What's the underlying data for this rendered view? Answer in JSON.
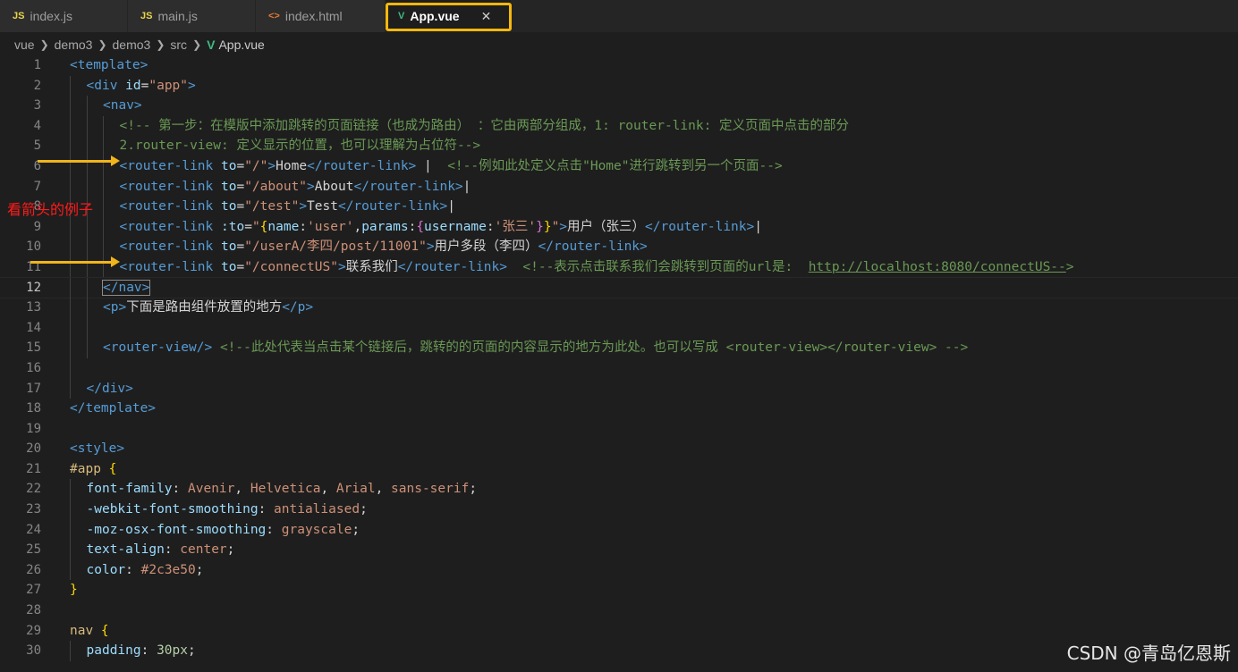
{
  "tabs": [
    {
      "icon": "JS",
      "label": "index.js"
    },
    {
      "icon": "JS",
      "label": "main.js"
    },
    {
      "icon": "<>",
      "label": "index.html"
    },
    {
      "icon": "V",
      "label": "App.vue",
      "close": "✕"
    }
  ],
  "breadcrumb": [
    "vue",
    "demo3",
    "demo3",
    "src",
    "App.vue"
  ],
  "annotation": "看箭头的例子",
  "watermark": "CSDN @青岛亿恩斯",
  "lines": [
    {
      "n": "1",
      "code": [
        [
          "t",
          "<template>"
        ]
      ]
    },
    {
      "n": "2",
      "code": [
        [
          "t",
          "<div "
        ],
        [
          "a",
          "id"
        ],
        [
          "tx",
          "="
        ],
        [
          "s",
          "\"app\""
        ],
        [
          "t",
          ">"
        ]
      ]
    },
    {
      "n": "3",
      "code": [
        [
          "t",
          "<nav>"
        ]
      ]
    },
    {
      "n": "4",
      "code": [
        [
          "c",
          "<!-- 第一步：在模版中添加跳转的页面链接（也成为路由） ：它由两部分组成，1: router-link: 定义页面中点击的部分"
        ]
      ]
    },
    {
      "n": "5",
      "code": [
        [
          "c",
          "2.router-view: 定义显示的位置，也可以理解为占位符-->"
        ]
      ]
    },
    {
      "n": "6",
      "code": [
        [
          "t",
          "<router-link "
        ],
        [
          "a",
          "to"
        ],
        [
          "tx",
          "="
        ],
        [
          "s",
          "\"/\""
        ],
        [
          "t",
          ">"
        ],
        [
          "tx",
          "Home"
        ],
        [
          "t",
          "</router-link>"
        ],
        [
          "tx",
          " |  "
        ],
        [
          "c",
          "<!--例如此处定义点击\"Home\"进行跳转到另一个页面-->"
        ]
      ]
    },
    {
      "n": "7",
      "code": [
        [
          "t",
          "<router-link "
        ],
        [
          "a",
          "to"
        ],
        [
          "tx",
          "="
        ],
        [
          "s",
          "\"/about\""
        ],
        [
          "t",
          ">"
        ],
        [
          "tx",
          "About"
        ],
        [
          "t",
          "</router-link>"
        ],
        [
          "tx",
          "|"
        ]
      ]
    },
    {
      "n": "8",
      "code": [
        [
          "t",
          "<router-link "
        ],
        [
          "a",
          "to"
        ],
        [
          "tx",
          "="
        ],
        [
          "s",
          "\"/test\""
        ],
        [
          "t",
          ">"
        ],
        [
          "tx",
          "Test"
        ],
        [
          "t",
          "</router-link>"
        ],
        [
          "tx",
          "|"
        ]
      ]
    },
    {
      "n": "9",
      "code": [
        [
          "t",
          "<router-link "
        ],
        [
          "a",
          ":to"
        ],
        [
          "tx",
          "="
        ],
        [
          "s",
          "\""
        ],
        [
          "br",
          "{"
        ],
        [
          "a",
          "name"
        ],
        [
          "tx",
          ":"
        ],
        [
          "s",
          "'user'"
        ],
        [
          "tx",
          ","
        ],
        [
          "a",
          "params"
        ],
        [
          "tx",
          ":"
        ],
        [
          "br2",
          "{"
        ],
        [
          "a",
          "username"
        ],
        [
          "tx",
          ":"
        ],
        [
          "s",
          "'张三'"
        ],
        [
          "br2",
          "}"
        ],
        [
          "br",
          "}"
        ],
        [
          "s",
          "\""
        ],
        [
          "t",
          ">"
        ],
        [
          "tx",
          "用户（张三）"
        ],
        [
          "t",
          "</router-link>"
        ],
        [
          "tx",
          "|"
        ]
      ]
    },
    {
      "n": "10",
      "code": [
        [
          "t",
          "<router-link "
        ],
        [
          "a",
          "to"
        ],
        [
          "tx",
          "="
        ],
        [
          "s",
          "\"/userA/李四/post/11001\""
        ],
        [
          "t",
          ">"
        ],
        [
          "tx",
          "用户多段（李四）"
        ],
        [
          "t",
          "</router-link>"
        ]
      ]
    },
    {
      "n": "11",
      "code": [
        [
          "t",
          "<router-link "
        ],
        [
          "a",
          "to"
        ],
        [
          "tx",
          "="
        ],
        [
          "s",
          "\"/connectUS\""
        ],
        [
          "t",
          ">"
        ],
        [
          "tx",
          "联系我们"
        ],
        [
          "t",
          "</router-link>"
        ],
        [
          "tx",
          "  "
        ],
        [
          "c",
          "<!--表示点击联系我们会跳转到页面的url是:  "
        ],
        [
          "link",
          "http://localhost:8080/connectUS--"
        ],
        [
          "c",
          ">"
        ]
      ]
    },
    {
      "n": "12",
      "code": [
        [
          "t",
          "</nav>"
        ]
      ]
    },
    {
      "n": "13",
      "code": [
        [
          "t",
          "<p>"
        ],
        [
          "tx",
          "下面是路由组件放置的地方"
        ],
        [
          "t",
          "</p>"
        ]
      ]
    },
    {
      "n": "14",
      "code": []
    },
    {
      "n": "15",
      "code": [
        [
          "t",
          "<router-view/>"
        ],
        [
          "tx",
          " "
        ],
        [
          "c",
          "<!--此处代表当点击某个链接后，跳转的的页面的内容显示的地方为此处。也可以写成 <router-view></router-view> -->"
        ]
      ]
    },
    {
      "n": "16",
      "code": []
    },
    {
      "n": "17",
      "code": [
        [
          "t",
          "</div>"
        ]
      ]
    },
    {
      "n": "18",
      "code": [
        [
          "t",
          "</template>"
        ]
      ]
    },
    {
      "n": "19",
      "code": []
    },
    {
      "n": "20",
      "code": [
        [
          "t",
          "<style>"
        ]
      ]
    },
    {
      "n": "21",
      "code": [
        [
          "sel",
          "#app "
        ],
        [
          "br",
          "{"
        ]
      ]
    },
    {
      "n": "22",
      "code": [
        [
          "a",
          "font-family"
        ],
        [
          "tx",
          ": "
        ],
        [
          "s",
          "Avenir"
        ],
        [
          "tx",
          ", "
        ],
        [
          "s",
          "Helvetica"
        ],
        [
          "tx",
          ", "
        ],
        [
          "s",
          "Arial"
        ],
        [
          "tx",
          ", "
        ],
        [
          "s",
          "sans-serif"
        ],
        [
          "tx",
          ";"
        ]
      ]
    },
    {
      "n": "23",
      "code": [
        [
          "a",
          "-webkit-font-smoothing"
        ],
        [
          "tx",
          ": "
        ],
        [
          "s",
          "antialiased"
        ],
        [
          "tx",
          ";"
        ]
      ]
    },
    {
      "n": "24",
      "code": [
        [
          "a",
          "-moz-osx-font-smoothing"
        ],
        [
          "tx",
          ": "
        ],
        [
          "s",
          "grayscale"
        ],
        [
          "tx",
          ";"
        ]
      ]
    },
    {
      "n": "25",
      "code": [
        [
          "a",
          "text-align"
        ],
        [
          "tx",
          ": "
        ],
        [
          "s",
          "center"
        ],
        [
          "tx",
          ";"
        ]
      ]
    },
    {
      "n": "26",
      "code": [
        [
          "a",
          "color"
        ],
        [
          "tx",
          ": "
        ],
        [
          "s",
          "#2c3e50"
        ],
        [
          "tx",
          ";"
        ]
      ]
    },
    {
      "n": "27",
      "code": [
        [
          "br",
          "}"
        ]
      ]
    },
    {
      "n": "28",
      "code": []
    },
    {
      "n": "29",
      "code": [
        [
          "sel",
          "nav "
        ],
        [
          "br",
          "{"
        ]
      ]
    },
    {
      "n": "30",
      "code": [
        [
          "a",
          "padding"
        ],
        [
          "tx",
          ": "
        ],
        [
          "n",
          "30px"
        ],
        [
          "tx",
          ";"
        ]
      ]
    }
  ]
}
